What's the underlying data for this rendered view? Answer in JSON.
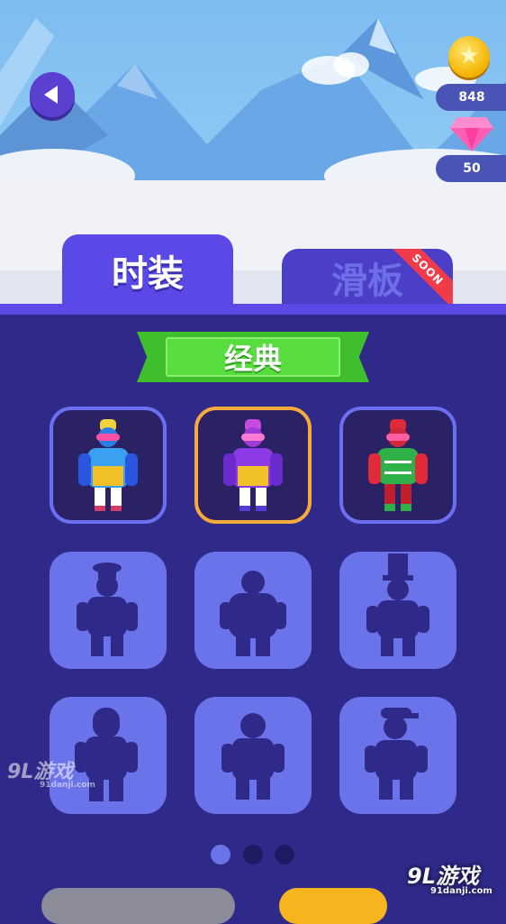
{
  "currency": {
    "coins": "848",
    "gems": "50",
    "coin_icon": "star-coin-icon",
    "gem_icon": "pink-diamond-icon"
  },
  "tabs": [
    {
      "label": "时装",
      "active": true
    },
    {
      "label": "滑板",
      "active": false,
      "badge": "SOON"
    }
  ],
  "category": {
    "title": "经典"
  },
  "outfits": [
    {
      "state": "owned",
      "selected": false,
      "icon": "blue-yellow-jacket-outfit-icon"
    },
    {
      "state": "owned",
      "selected": true,
      "icon": "purple-yellow-jacket-outfit-icon"
    },
    {
      "state": "owned",
      "selected": false,
      "icon": "christmas-sweater-outfit-icon"
    },
    {
      "state": "locked",
      "icon": "chef-hat-silhouette-icon"
    },
    {
      "state": "locked",
      "icon": "bulky-jacket-silhouette-icon"
    },
    {
      "state": "locked",
      "icon": "top-hat-silhouette-icon"
    },
    {
      "state": "locked",
      "icon": "hooded-silhouette-icon"
    },
    {
      "state": "locked",
      "icon": "round-head-silhouette-icon"
    },
    {
      "state": "locked",
      "icon": "cap-silhouette-icon"
    }
  ],
  "pager": {
    "pages": 3,
    "current": 1
  },
  "colors": {
    "panel": "#2f2a8a",
    "tab_active": "#5a49e6",
    "ribbon": "#57dd3e",
    "selected_border": "#f8a93b",
    "locked_slot": "#6b73ea"
  },
  "watermark": {
    "brand": "9L游戏",
    "url": "91danji.com"
  }
}
